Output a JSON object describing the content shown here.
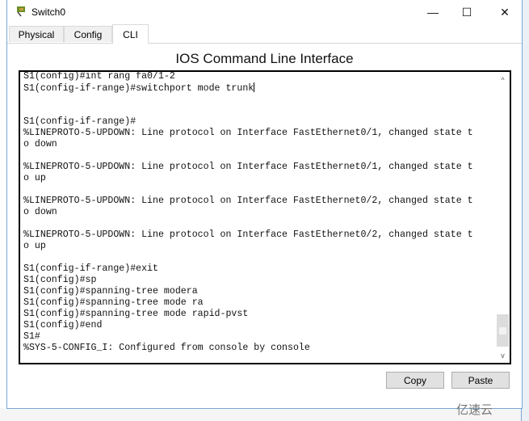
{
  "window": {
    "title": "Switch0",
    "minimize": "—",
    "maximize": "☐",
    "close": "✕"
  },
  "tabs": [
    {
      "label": "Physical"
    },
    {
      "label": "Config"
    },
    {
      "label": "CLI",
      "active": true
    }
  ],
  "heading": "IOS Command Line Interface",
  "terminal": {
    "lines": [
      "S1(config)#int rang fa0/1-2",
      "S1(config-if-range)#switchport mode trunk",
      "",
      "",
      "S1(config-if-range)#",
      "%LINEPROTO-5-UPDOWN: Line protocol on Interface FastEthernet0/1, changed state t",
      "o down",
      "",
      "%LINEPROTO-5-UPDOWN: Line protocol on Interface FastEthernet0/1, changed state t",
      "o up",
      "",
      "%LINEPROTO-5-UPDOWN: Line protocol on Interface FastEthernet0/2, changed state t",
      "o down",
      "",
      "%LINEPROTO-5-UPDOWN: Line protocol on Interface FastEthernet0/2, changed state t",
      "o up",
      "",
      "S1(config-if-range)#exit",
      "S1(config)#sp",
      "S1(config)#spanning-tree modera",
      "S1(config)#spanning-tree mode ra",
      "S1(config)#spanning-tree mode rapid-pvst",
      "S1(config)#end",
      "S1#",
      "%SYS-5-CONFIG_I: Configured from console by console"
    ],
    "scroll_position": 0.95
  },
  "buttons": {
    "copy": "Copy",
    "paste": "Paste"
  },
  "watermark": "亿速云"
}
